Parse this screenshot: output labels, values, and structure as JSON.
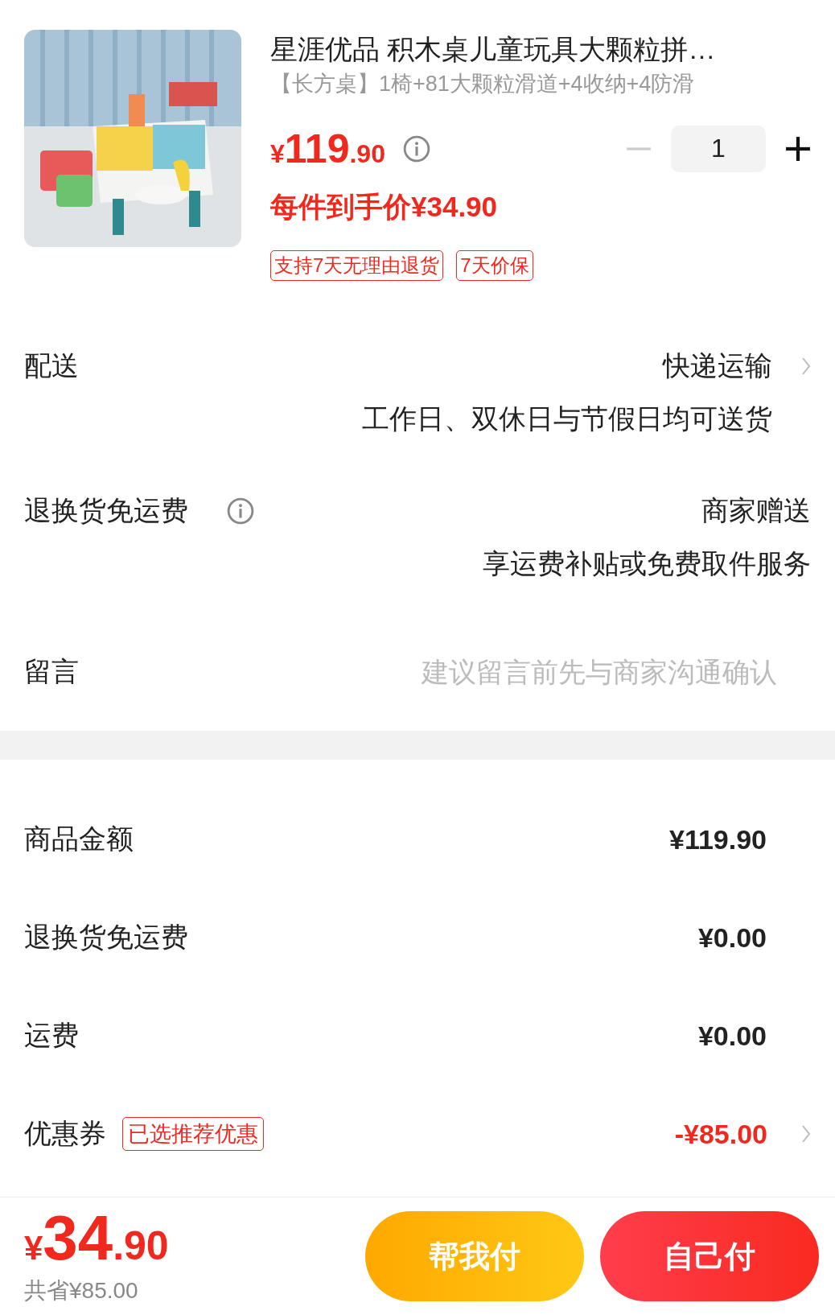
{
  "product": {
    "image": {
      "kind": "picture"
    },
    "title": "星涯优品 积木桌儿童玩具大颗粒拼…",
    "spec": "【长方桌】1椅+81大颗粒滑道+4收纳+4防滑",
    "price": {
      "symbol": "¥",
      "integer": "119",
      "decimal": ".90"
    },
    "unit_price": "每件到手价¥34.90",
    "quantity": "1",
    "tags": [
      "支持7天无理由退货",
      "7天价保"
    ]
  },
  "delivery": [
    {
      "kind": "choice",
      "label": "配送",
      "value": "快递运输",
      "note": "工作日、双休日与节假日均可送货",
      "info": false,
      "chevron": true
    },
    {
      "kind": "choice",
      "label": "退换货免运费",
      "value": "商家赠送",
      "note": "享运费补贴或免费取件服务",
      "info": true,
      "chevron": false
    },
    {
      "kind": "message",
      "label": "留言",
      "placeholder": "建议留言前先与商家沟通确认"
    }
  ],
  "summary": [
    {
      "label": "商品金额",
      "value": "¥119.90",
      "discount": false,
      "chevron": false
    },
    {
      "label": "退换货免运费",
      "value": "¥0.00",
      "discount": false,
      "chevron": false
    },
    {
      "label": "运费",
      "value": "¥0.00",
      "discount": false,
      "chevron": false
    },
    {
      "label": "优惠券",
      "badge": "已选推荐优惠",
      "value": "-¥85.00",
      "discount": true,
      "chevron": true
    }
  ],
  "footer": {
    "total": {
      "symbol": "¥",
      "integer": "34",
      "decimal": ".90"
    },
    "saved": "共省¥85.00",
    "buttons": [
      {
        "kind": "secondary",
        "label": "帮我付"
      },
      {
        "kind": "primary",
        "label": "自己付"
      }
    ]
  }
}
